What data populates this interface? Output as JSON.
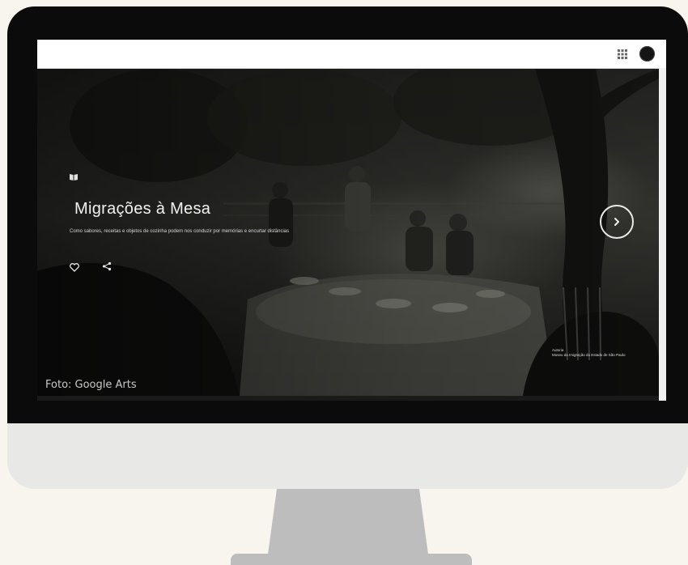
{
  "page": {
    "hero": {
      "title": "Migrações à Mesa",
      "subtitle": "Como sabores, receitas e objetos de cozinha podem nos conduzir por memórias e encurtar distâncias",
      "credit_line1": "Autoria",
      "credit_line2": "Museu da Imigração do Estado de São Paulo"
    },
    "caption": "Foto: Google Arts"
  },
  "icons": {
    "apps": "grid-icon",
    "avatar": "user-avatar",
    "book": "book-icon",
    "favorite": "heart-icon",
    "share": "share-icon",
    "next": "chevron-right-icon"
  },
  "colors": {
    "background": "#f8f5ee",
    "monitor_body": "#e8e8e6",
    "bezel": "#0b0b0b",
    "stand": "#bdbdbd",
    "hero_text": "#f2f2f2"
  }
}
